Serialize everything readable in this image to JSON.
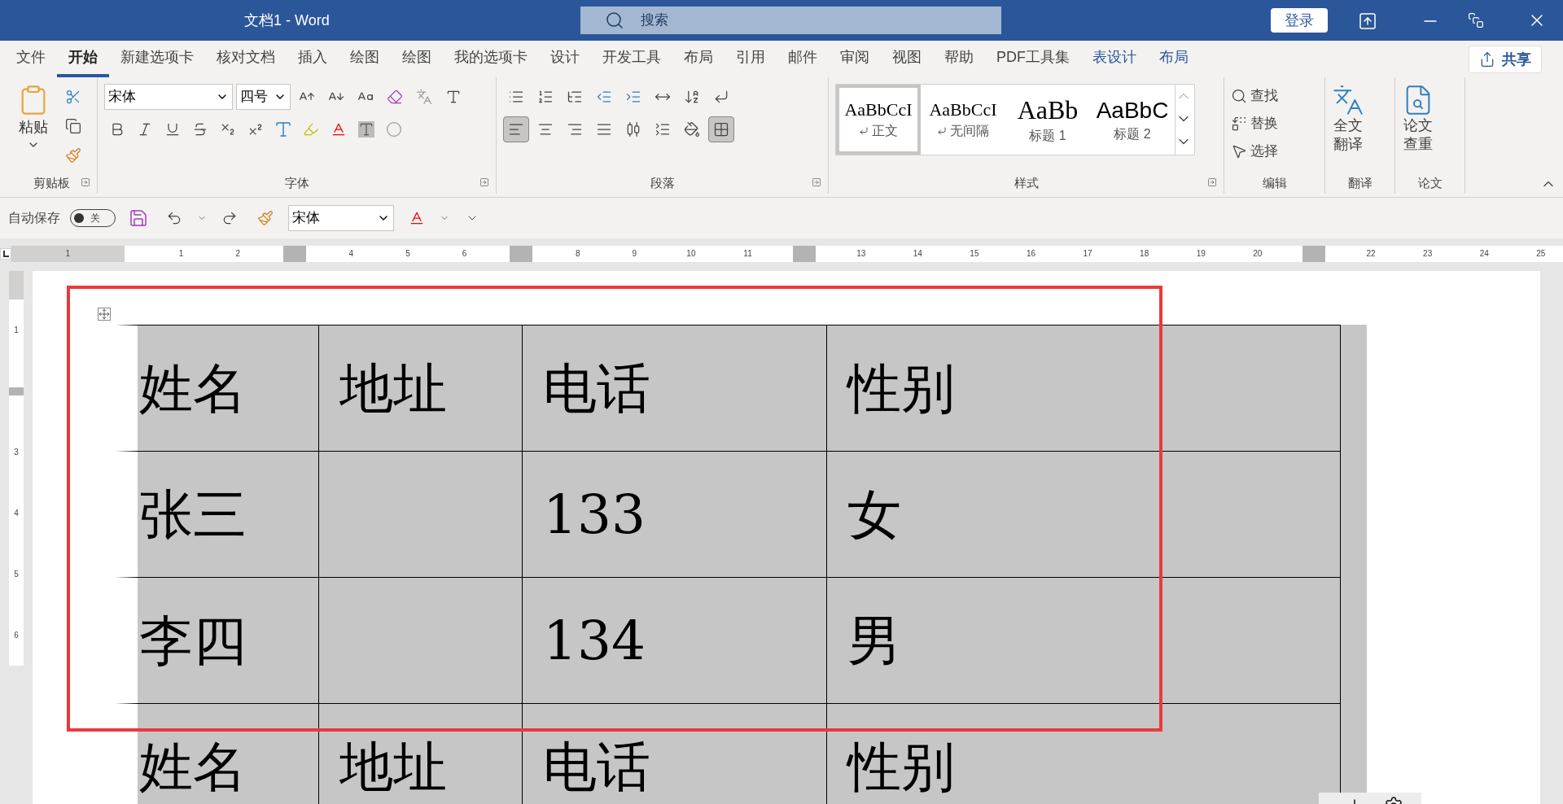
{
  "title_bar": {
    "title": "文档1  -  Word",
    "search_placeholder": "搜索",
    "login_button": "登录"
  },
  "tabs": [
    {
      "label": "文件",
      "selected": false,
      "kind": "normal"
    },
    {
      "label": "开始",
      "selected": true,
      "kind": "normal"
    },
    {
      "label": "新建选项卡",
      "selected": false,
      "kind": "normal"
    },
    {
      "label": "核对文档",
      "selected": false,
      "kind": "normal"
    },
    {
      "label": "插入",
      "selected": false,
      "kind": "normal"
    },
    {
      "label": "绘图",
      "selected": false,
      "kind": "normal"
    },
    {
      "label": "绘图",
      "selected": false,
      "kind": "normal"
    },
    {
      "label": "我的选项卡",
      "selected": false,
      "kind": "normal"
    },
    {
      "label": "设计",
      "selected": false,
      "kind": "normal"
    },
    {
      "label": "开发工具",
      "selected": false,
      "kind": "normal"
    },
    {
      "label": "布局",
      "selected": false,
      "kind": "normal"
    },
    {
      "label": "引用",
      "selected": false,
      "kind": "normal"
    },
    {
      "label": "邮件",
      "selected": false,
      "kind": "normal"
    },
    {
      "label": "审阅",
      "selected": false,
      "kind": "normal"
    },
    {
      "label": "视图",
      "selected": false,
      "kind": "normal"
    },
    {
      "label": "帮助",
      "selected": false,
      "kind": "normal"
    },
    {
      "label": "PDF工具集",
      "selected": false,
      "kind": "normal"
    },
    {
      "label": "表设计",
      "selected": false,
      "kind": "contextual"
    },
    {
      "label": "布局",
      "selected": false,
      "kind": "contextual"
    }
  ],
  "share_button": "共享",
  "ribbon": {
    "clipboard": {
      "paste": "粘贴",
      "group_label": "剪贴板"
    },
    "font": {
      "font_name": "宋体",
      "font_size": "四号",
      "group_label": "字体"
    },
    "paragraph": {
      "group_label": "段落",
      "align_selected": [
        true,
        false,
        false,
        false,
        false
      ],
      "borders_selected": true
    },
    "styles": {
      "group_label": "样式",
      "items": [
        {
          "sample": "AaBbCcI",
          "name": "正文",
          "selected": true,
          "kind": "body"
        },
        {
          "sample": "AaBbCcI",
          "name": "无间隔",
          "selected": false,
          "kind": "body"
        },
        {
          "sample": "AaBb",
          "name": "标题 1",
          "selected": false,
          "kind": "heading1"
        },
        {
          "sample": "AaBbC",
          "name": "标题 2",
          "selected": false,
          "kind": "heading2"
        }
      ]
    },
    "editing": {
      "group_label": "编辑",
      "items": [
        {
          "label": "查找",
          "kind": "find"
        },
        {
          "label": "替换",
          "kind": "replace"
        },
        {
          "label": "选择",
          "kind": "select"
        }
      ]
    },
    "translate": {
      "button": [
        "全文",
        "翻译"
      ],
      "group_label": "翻译"
    },
    "paper": {
      "button": [
        "论文",
        "查重"
      ],
      "group_label": "论文"
    }
  },
  "quick_access": {
    "autosave_label": "自动保存",
    "autosave": {
      "on": false,
      "label": "关"
    },
    "font_name": "宋体"
  },
  "horizontal_ruler": [
    {
      "kind": "number",
      "label": "1"
    },
    {
      "kind": "origin"
    },
    {
      "kind": "number",
      "label": "1"
    },
    {
      "kind": "number",
      "label": "2"
    },
    {
      "kind": "marker"
    },
    {
      "kind": "number",
      "label": "4"
    },
    {
      "kind": "number",
      "label": "5"
    },
    {
      "kind": "number",
      "label": "6"
    },
    {
      "kind": "marker"
    },
    {
      "kind": "number",
      "label": "8"
    },
    {
      "kind": "number",
      "label": "9"
    },
    {
      "kind": "number",
      "label": "10"
    },
    {
      "kind": "number",
      "label": "11"
    },
    {
      "kind": "marker"
    },
    {
      "kind": "number",
      "label": "13"
    },
    {
      "kind": "number",
      "label": "14"
    },
    {
      "kind": "number",
      "label": "15"
    },
    {
      "kind": "number",
      "label": "16"
    },
    {
      "kind": "number",
      "label": "17"
    },
    {
      "kind": "number",
      "label": "18"
    },
    {
      "kind": "number",
      "label": "19"
    },
    {
      "kind": "number",
      "label": "20"
    },
    {
      "kind": "marker"
    },
    {
      "kind": "number",
      "label": "22"
    },
    {
      "kind": "number",
      "label": "23"
    },
    {
      "kind": "number",
      "label": "24"
    },
    {
      "kind": "number",
      "label": "25"
    }
  ],
  "vertical_ruler": [
    {
      "kind": "number",
      "label": "1"
    },
    {
      "kind": "marker"
    },
    {
      "kind": "number",
      "label": "3"
    },
    {
      "kind": "number",
      "label": "4"
    },
    {
      "kind": "number",
      "label": "5"
    },
    {
      "kind": "number",
      "label": "6"
    }
  ],
  "table": {
    "selected": true,
    "highlighted": true,
    "rows": [
      [
        "姓名",
        "地址",
        "电话",
        "性别"
      ],
      [
        "张三",
        null,
        "133",
        "女"
      ],
      [
        "李四",
        null,
        "134",
        "男"
      ],
      [
        "姓名",
        "地址",
        "电话",
        "性别"
      ]
    ]
  }
}
